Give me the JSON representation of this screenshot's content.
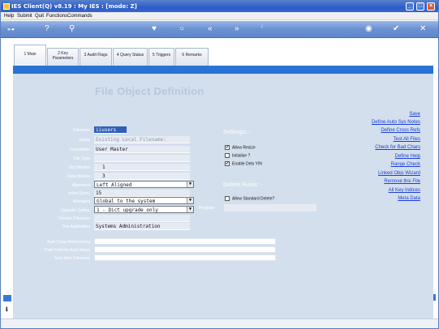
{
  "window": {
    "title": "IES Client(Q) v8.19 : My IES :        [mode: Z]"
  },
  "menu": [
    "Help",
    "Submit",
    "Quit",
    "Functions",
    "Commands"
  ],
  "toolbar_icons": [
    "key-icon",
    "help-icon",
    "search-icon",
    "heart-icon",
    "circle-icon",
    "rewind-icon",
    "forward-icon",
    "info-icon",
    "globe-icon",
    "check-icon",
    "close-icon"
  ],
  "tabs": [
    {
      "label": "1 Main",
      "active": true
    },
    {
      "label": "2 Key Parameters",
      "line1": "2 Key",
      "line2": "Parameters"
    },
    {
      "label": "3 Audit Flags"
    },
    {
      "label": "4 Query Status"
    },
    {
      "label": "5 Triggers"
    },
    {
      "label": "6 Remarks"
    }
  ],
  "form": {
    "heading": "File Object Definition",
    "fields": {
      "filename": {
        "label": "Filename",
        "value": "iiusers"
      },
      "status": {
        "label": "Status",
        "value": "Existing Local Filename:"
      },
      "description": {
        "label": "Description",
        "value": "User Master"
      },
      "file_type": {
        "label": "File Type",
        "value": ""
      },
      "dict_models": {
        "label": "Dict Models",
        "value": "1"
      },
      "data_models": {
        "label": "Data Models",
        "value": "3"
      },
      "alignment": {
        "label": "Alignment",
        "value": "Left Aligned"
      },
      "index_query": {
        "label": "Index Query",
        "value": "15"
      },
      "managed": {
        "label": "Managed",
        "value": "Global to the system"
      },
      "upgrade_setting": {
        "label": "Upgrade Setting",
        "value": "1 - Dict upgrade only"
      },
      "version_filename": {
        "label": "Version Filename",
        "value": ""
      },
      "doc_application": {
        "label": "Doc Application",
        "value": "Systems Administration"
      }
    },
    "settings": {
      "heading": "Settings: -",
      "allow_resize": {
        "label": "Allow Resize",
        "checked": true
      },
      "initialise": {
        "label": "Initialise ?",
        "checked": false
      },
      "enable_dets": {
        "label": "Enable Dets Y/N",
        "checked": true
      }
    },
    "delete_rules": {
      "heading": "Delete Rules: -",
      "allow_standard_delete": {
        "label": "Allow Standard Delete?",
        "checked": false
      },
      "program_label": "Program",
      "program_value": ""
    },
    "lower": {
      "auto_cross_referencing": "Auto Cross Referencing",
      "date_field_auto_notes": "Date Field for Auto Notes",
      "sync_alert_filename": "Sync Alert Filename"
    }
  },
  "links": [
    "Save",
    "Define Auto Sys Notes",
    "Define Cross Refs",
    "Test All Files",
    "Check for Bad Chars",
    "Define Help",
    "Range Check",
    "Linked Objs Wizard",
    "Remove this File",
    "All Key Indices",
    "Meta Data"
  ],
  "colors": {
    "accent_blue": "#2a73d6",
    "panel": "#d3dfed",
    "link": "#1c3fd6",
    "titlebar": "#2d5cc4"
  }
}
